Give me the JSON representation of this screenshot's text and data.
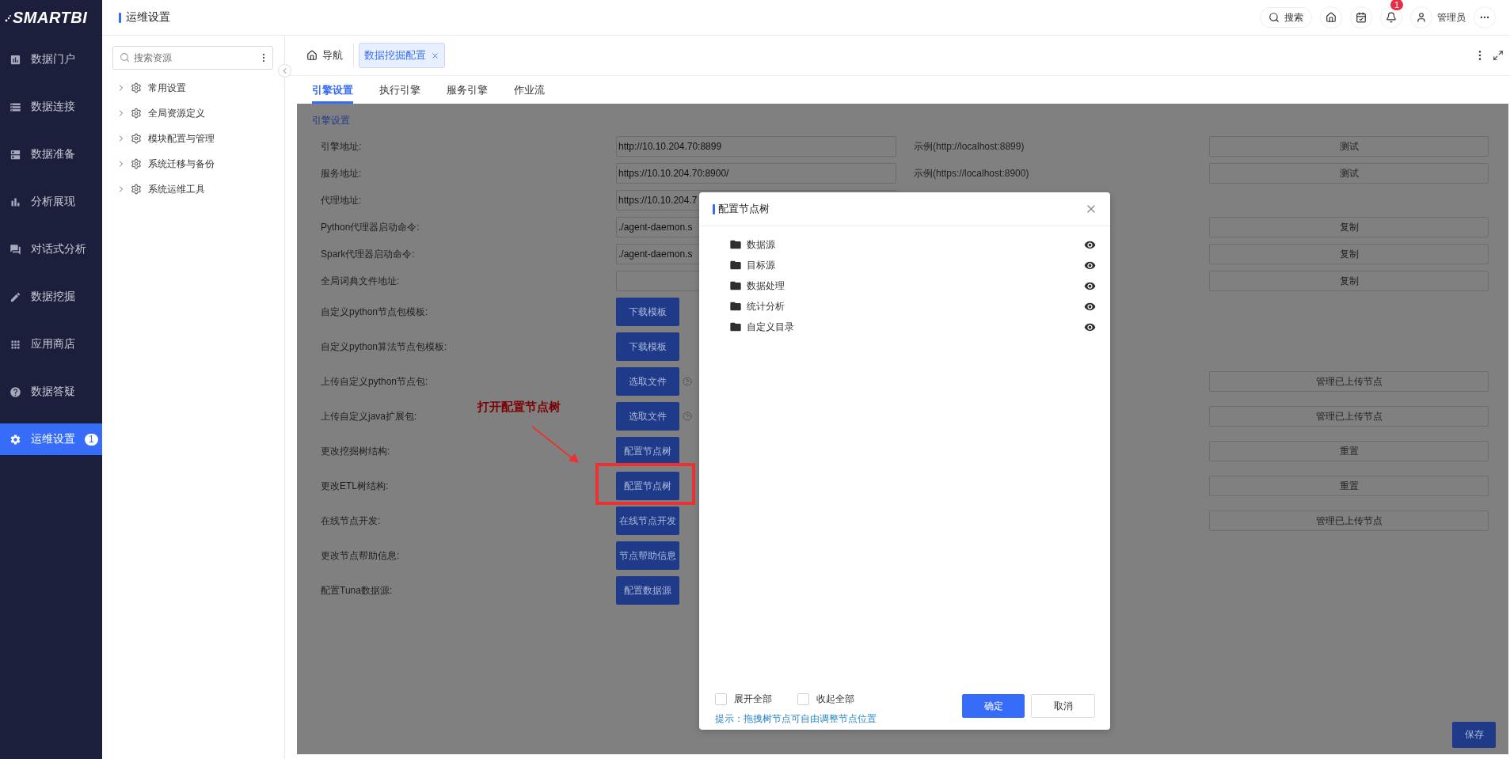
{
  "logo": "SMARTBI",
  "header": {
    "title": "运维设置",
    "search": "搜索",
    "notifications": "1",
    "user": "管理员"
  },
  "nav": [
    {
      "label": "数据门户",
      "selected": false
    },
    {
      "label": "数据连接",
      "selected": false
    },
    {
      "label": "数据准备",
      "selected": false
    },
    {
      "label": "分析展现",
      "selected": false
    },
    {
      "label": "对话式分析",
      "selected": false
    },
    {
      "label": "数据挖掘",
      "selected": false
    },
    {
      "label": "应用商店",
      "selected": false
    },
    {
      "label": "数据答疑",
      "selected": false
    },
    {
      "label": "运维设置",
      "selected": true,
      "badge": "1"
    }
  ],
  "resources": {
    "placeholder": "搜索资源",
    "items": [
      {
        "label": "常用设置"
      },
      {
        "label": "全局资源定义"
      },
      {
        "label": "模块配置与管理"
      },
      {
        "label": "系统迁移与备份"
      },
      {
        "label": "系统运维工具"
      }
    ]
  },
  "page_tabs": [
    {
      "label": "导航",
      "selected": false,
      "kind": "home"
    },
    {
      "label": "数据挖掘配置",
      "selected": true,
      "kind": "closable"
    }
  ],
  "sub_tabs": [
    {
      "label": "引擎设置",
      "selected": true
    },
    {
      "label": "执行引擎",
      "selected": false
    },
    {
      "label": "服务引擎",
      "selected": false
    },
    {
      "label": "作业流",
      "selected": false
    }
  ],
  "section": "引擎设置",
  "rows": [
    {
      "label": "引擎地址:",
      "kind": "input",
      "value": "http://10.10.204.70:8899",
      "example": "示例(http://localhost:8899)",
      "action": "测试"
    },
    {
      "label": "服务地址:",
      "kind": "input",
      "value": "https://10.10.204.70:8900/",
      "example": "示例(https://localhost:8900)",
      "action": "测试"
    },
    {
      "label": "代理地址:",
      "kind": "input",
      "value": "https://10.10.204.7"
    },
    {
      "label": "Python代理器启动命令:",
      "kind": "input",
      "value": "./agent-daemon.s",
      "action": "复制"
    },
    {
      "label": "Spark代理器启动命令:",
      "kind": "input",
      "value": "./agent-daemon.s",
      "action": "复制"
    },
    {
      "label": "全局词典文件地址:",
      "kind": "input",
      "action": "复制"
    },
    {
      "label": "自定义python节点包模板:",
      "kind": "button",
      "button": "下载模板"
    },
    {
      "label": "自定义python算法节点包模板:",
      "kind": "button",
      "button": "下载模板"
    },
    {
      "label": "上传自定义python节点包:",
      "kind": "button",
      "button": "选取文件",
      "help": true,
      "action": "管理已上传节点"
    },
    {
      "label": "上传自定义java扩展包:",
      "kind": "button",
      "button": "选取文件",
      "help": true,
      "action": "管理已上传节点"
    },
    {
      "label": "更改挖掘树结构:",
      "kind": "button",
      "button": "配置节点树",
      "action": "重置"
    },
    {
      "label": "更改ETL树结构:",
      "kind": "button",
      "button": "配置节点树",
      "action": "重置"
    },
    {
      "label": "在线节点开发:",
      "kind": "button",
      "button": "在线节点开发",
      "action": "管理已上传节点"
    },
    {
      "label": "更改节点帮助信息:",
      "kind": "button",
      "button": "节点帮助信息"
    },
    {
      "label": "配置Tuna数据源:",
      "kind": "button",
      "button": "配置数据源"
    }
  ],
  "annotation": {
    "text": "打开配置节点树"
  },
  "save": "保存",
  "dialog": {
    "title": "配置节点树",
    "items": [
      {
        "label": "数据源",
        "visible": true
      },
      {
        "label": "目标源",
        "visible": true
      },
      {
        "label": "数据处理",
        "visible": true
      },
      {
        "label": "统计分析",
        "visible": true
      },
      {
        "label": "自定义目录",
        "visible": true
      }
    ],
    "options": [
      {
        "label": "展开全部",
        "checked": false
      },
      {
        "label": "收起全部",
        "checked": false
      }
    ],
    "hint": "提示：拖拽树节点可自由调整节点位置",
    "buttons": [
      {
        "label": "确定",
        "primary": true
      },
      {
        "label": "取消",
        "primary": false
      }
    ]
  }
}
